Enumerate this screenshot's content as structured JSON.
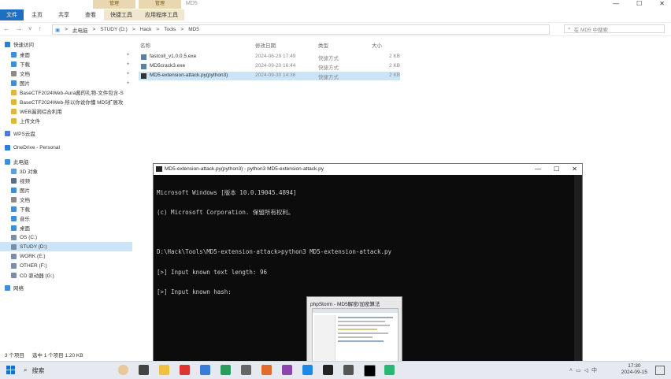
{
  "window": {
    "title": "MD5",
    "context_tabs": [
      "管理",
      "管理"
    ],
    "ribbon_tabs": [
      "文件",
      "主页",
      "共享",
      "查看",
      "快捷工具",
      "应用程序工具"
    ],
    "controls": [
      "—",
      "☐",
      "✕"
    ]
  },
  "address": {
    "crumbs": [
      "此电脑",
      ">",
      "STUDY (D:)",
      ">",
      "Hack",
      ">",
      "Tools",
      ">",
      "MD5"
    ],
    "search_placeholder": "在 MD5 中搜索"
  },
  "sidebar": {
    "items": [
      {
        "label": "快速访问",
        "icon": "star-icon",
        "color": "#2f7bd6"
      },
      {
        "label": "桌面",
        "icon": "desktop-icon",
        "color": "#3c8fd8",
        "pinned": true
      },
      {
        "label": "下载",
        "icon": "download-icon",
        "color": "#3c8fd8",
        "pinned": true
      },
      {
        "label": "文档",
        "icon": "document-icon",
        "color": "#8a8a8a",
        "pinned": true
      },
      {
        "label": "图片",
        "icon": "picture-icon",
        "color": "#3c8fd8",
        "pinned": true
      },
      {
        "label": "BaseCTF2024Web-Aura酱的礼物-文件包含-S",
        "icon": "folder-icon",
        "color": "#e3b341"
      },
      {
        "label": "BaseCTF2024Web-所以你说你懂 MD5扩展攻",
        "icon": "folder-icon",
        "color": "#e3b341"
      },
      {
        "label": "WEB漏洞综合利用",
        "icon": "folder-icon",
        "color": "#e3b341"
      },
      {
        "label": "上传文件",
        "icon": "folder-icon",
        "color": "#e3b341"
      },
      {
        "label": "WPS云盘",
        "icon": "cloud-icon",
        "color": "#4a7bd0"
      },
      {
        "label": "OneDrive - Personal",
        "icon": "onedrive-icon",
        "color": "#2f7bd6"
      },
      {
        "label": "此电脑",
        "icon": "computer-icon",
        "color": "#3c8fd8"
      },
      {
        "label": "3D 对象",
        "icon": "cube-icon",
        "color": "#5aa0e0"
      },
      {
        "label": "视频",
        "icon": "video-icon",
        "color": "#5a6e8a"
      },
      {
        "label": "图片",
        "icon": "picture-icon",
        "color": "#3c8fd8"
      },
      {
        "label": "文档",
        "icon": "document-icon",
        "color": "#8a8a8a"
      },
      {
        "label": "下载",
        "icon": "download-icon",
        "color": "#3c8fd8"
      },
      {
        "label": "音乐",
        "icon": "music-icon",
        "color": "#3c8fd8"
      },
      {
        "label": "桌面",
        "icon": "desktop-icon",
        "color": "#3c8fd8"
      },
      {
        "label": "OS (C:)",
        "icon": "drive-icon",
        "color": "#7a8ea8"
      },
      {
        "label": "STUDY (D:)",
        "icon": "drive-icon",
        "color": "#7a8ea8",
        "selected": true
      },
      {
        "label": "WORK (E:)",
        "icon": "drive-icon",
        "color": "#7a8ea8"
      },
      {
        "label": "OTHER (F:)",
        "icon": "drive-icon",
        "color": "#7a8ea8"
      },
      {
        "label": "CD 驱动器 (G:)",
        "icon": "cd-icon",
        "color": "#7a8ea8"
      },
      {
        "label": "网络",
        "icon": "network-icon",
        "color": "#3c8fd8"
      }
    ]
  },
  "files": {
    "columns": [
      "名称",
      "修改日期",
      "类型",
      "大小"
    ],
    "rows": [
      {
        "name": "fastcoll_v1.0.0.5.exe",
        "date": "2024-06-29 17:49",
        "type": "快捷方式",
        "size": "2 KB"
      },
      {
        "name": "MD5crack3.exe",
        "date": "2024-09-20 16:44",
        "type": "快捷方式",
        "size": "2 KB"
      },
      {
        "name": "MD5-extension-attack.py(python3)",
        "date": "2024-09-30 14:36",
        "type": "快捷方式",
        "size": "2 KB",
        "selected": true
      }
    ]
  },
  "status": {
    "count": "3 个项目",
    "selection": "选中 1 个项目  1.20 KB"
  },
  "terminal": {
    "title": "MD5-extension-attack.py(python3) - python3  MD5-extension-attack.py",
    "lines": [
      "Microsoft Windows [版本 10.0.19045.4894]",
      "(c) Microsoft Corporation. 保留所有权利。",
      "",
      "D:\\Hack\\Tools\\MD5-extension-attack>python3 MD5-extension-attack.py",
      "[>] Input known text length: 96",
      "[>] Input known hash:"
    ]
  },
  "thumbnail": {
    "title": "phpStorm - MD5解密/加密算法"
  },
  "taskbar": {
    "search": "搜索",
    "time": "17:30",
    "date": "2024-09-15",
    "lang": "中"
  }
}
